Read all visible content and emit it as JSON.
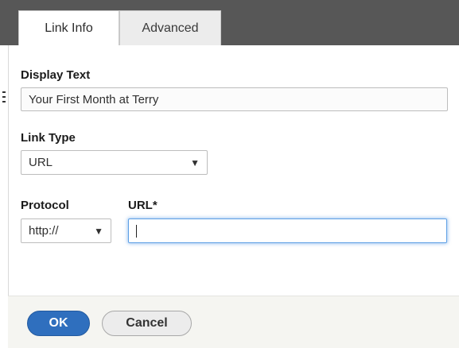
{
  "tabs": [
    {
      "label": "Link Info",
      "active": true
    },
    {
      "label": "Advanced",
      "active": false
    }
  ],
  "form": {
    "display_text": {
      "label": "Display Text",
      "value": "Your First Month at Terry"
    },
    "link_type": {
      "label": "Link Type",
      "selected": "URL"
    },
    "protocol": {
      "label": "Protocol",
      "selected": "http://"
    },
    "url": {
      "label": "URL*",
      "value": ""
    }
  },
  "buttons": {
    "ok_label": "OK",
    "cancel_label": "Cancel"
  },
  "colors": {
    "ok_button": "#2f6fbe",
    "focus_ring": "#5ea0e6",
    "header_background": "#575757"
  }
}
